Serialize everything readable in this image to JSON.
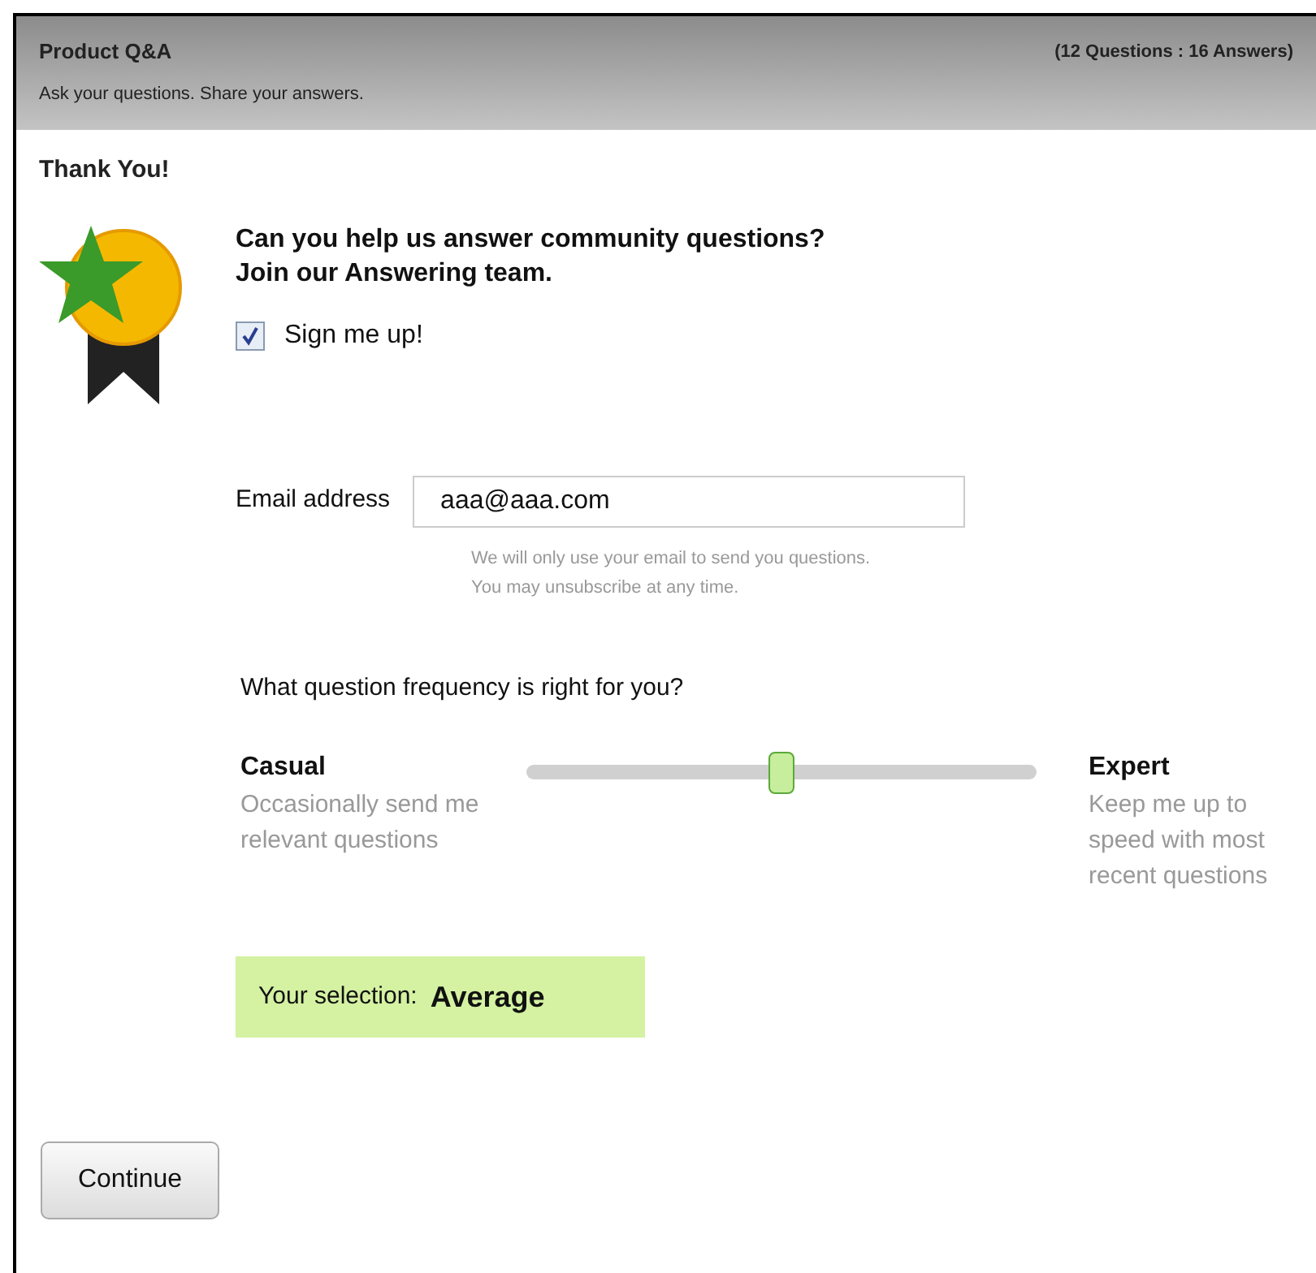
{
  "header": {
    "title": "Product Q&A",
    "count": "(12 Questions : 16 Answers)",
    "subtitle": "Ask your questions. Share your answers."
  },
  "heading": "Thank You!",
  "prompt": {
    "line_1": "Can you help us answer community questions?",
    "line_2": "Join our Answering team."
  },
  "signup": {
    "label": "Sign me up!",
    "checked": true
  },
  "email": {
    "label": "Email address",
    "value": "aaa@aaa.com",
    "hint_1": "We will only use your email to send you questions.",
    "hint_2": "You may unsubscribe at any time."
  },
  "frequency": {
    "question": "What question frequency is right for you?",
    "level": 0.5,
    "low": {
      "title": "Casual",
      "description": "Occasionally send me relevant questions"
    },
    "high": {
      "title": "Expert",
      "description": "Keep me up to speed with most recent questions"
    }
  },
  "selection": {
    "label": "Your selection:",
    "value": "Average"
  },
  "continue_button": "Continue"
}
